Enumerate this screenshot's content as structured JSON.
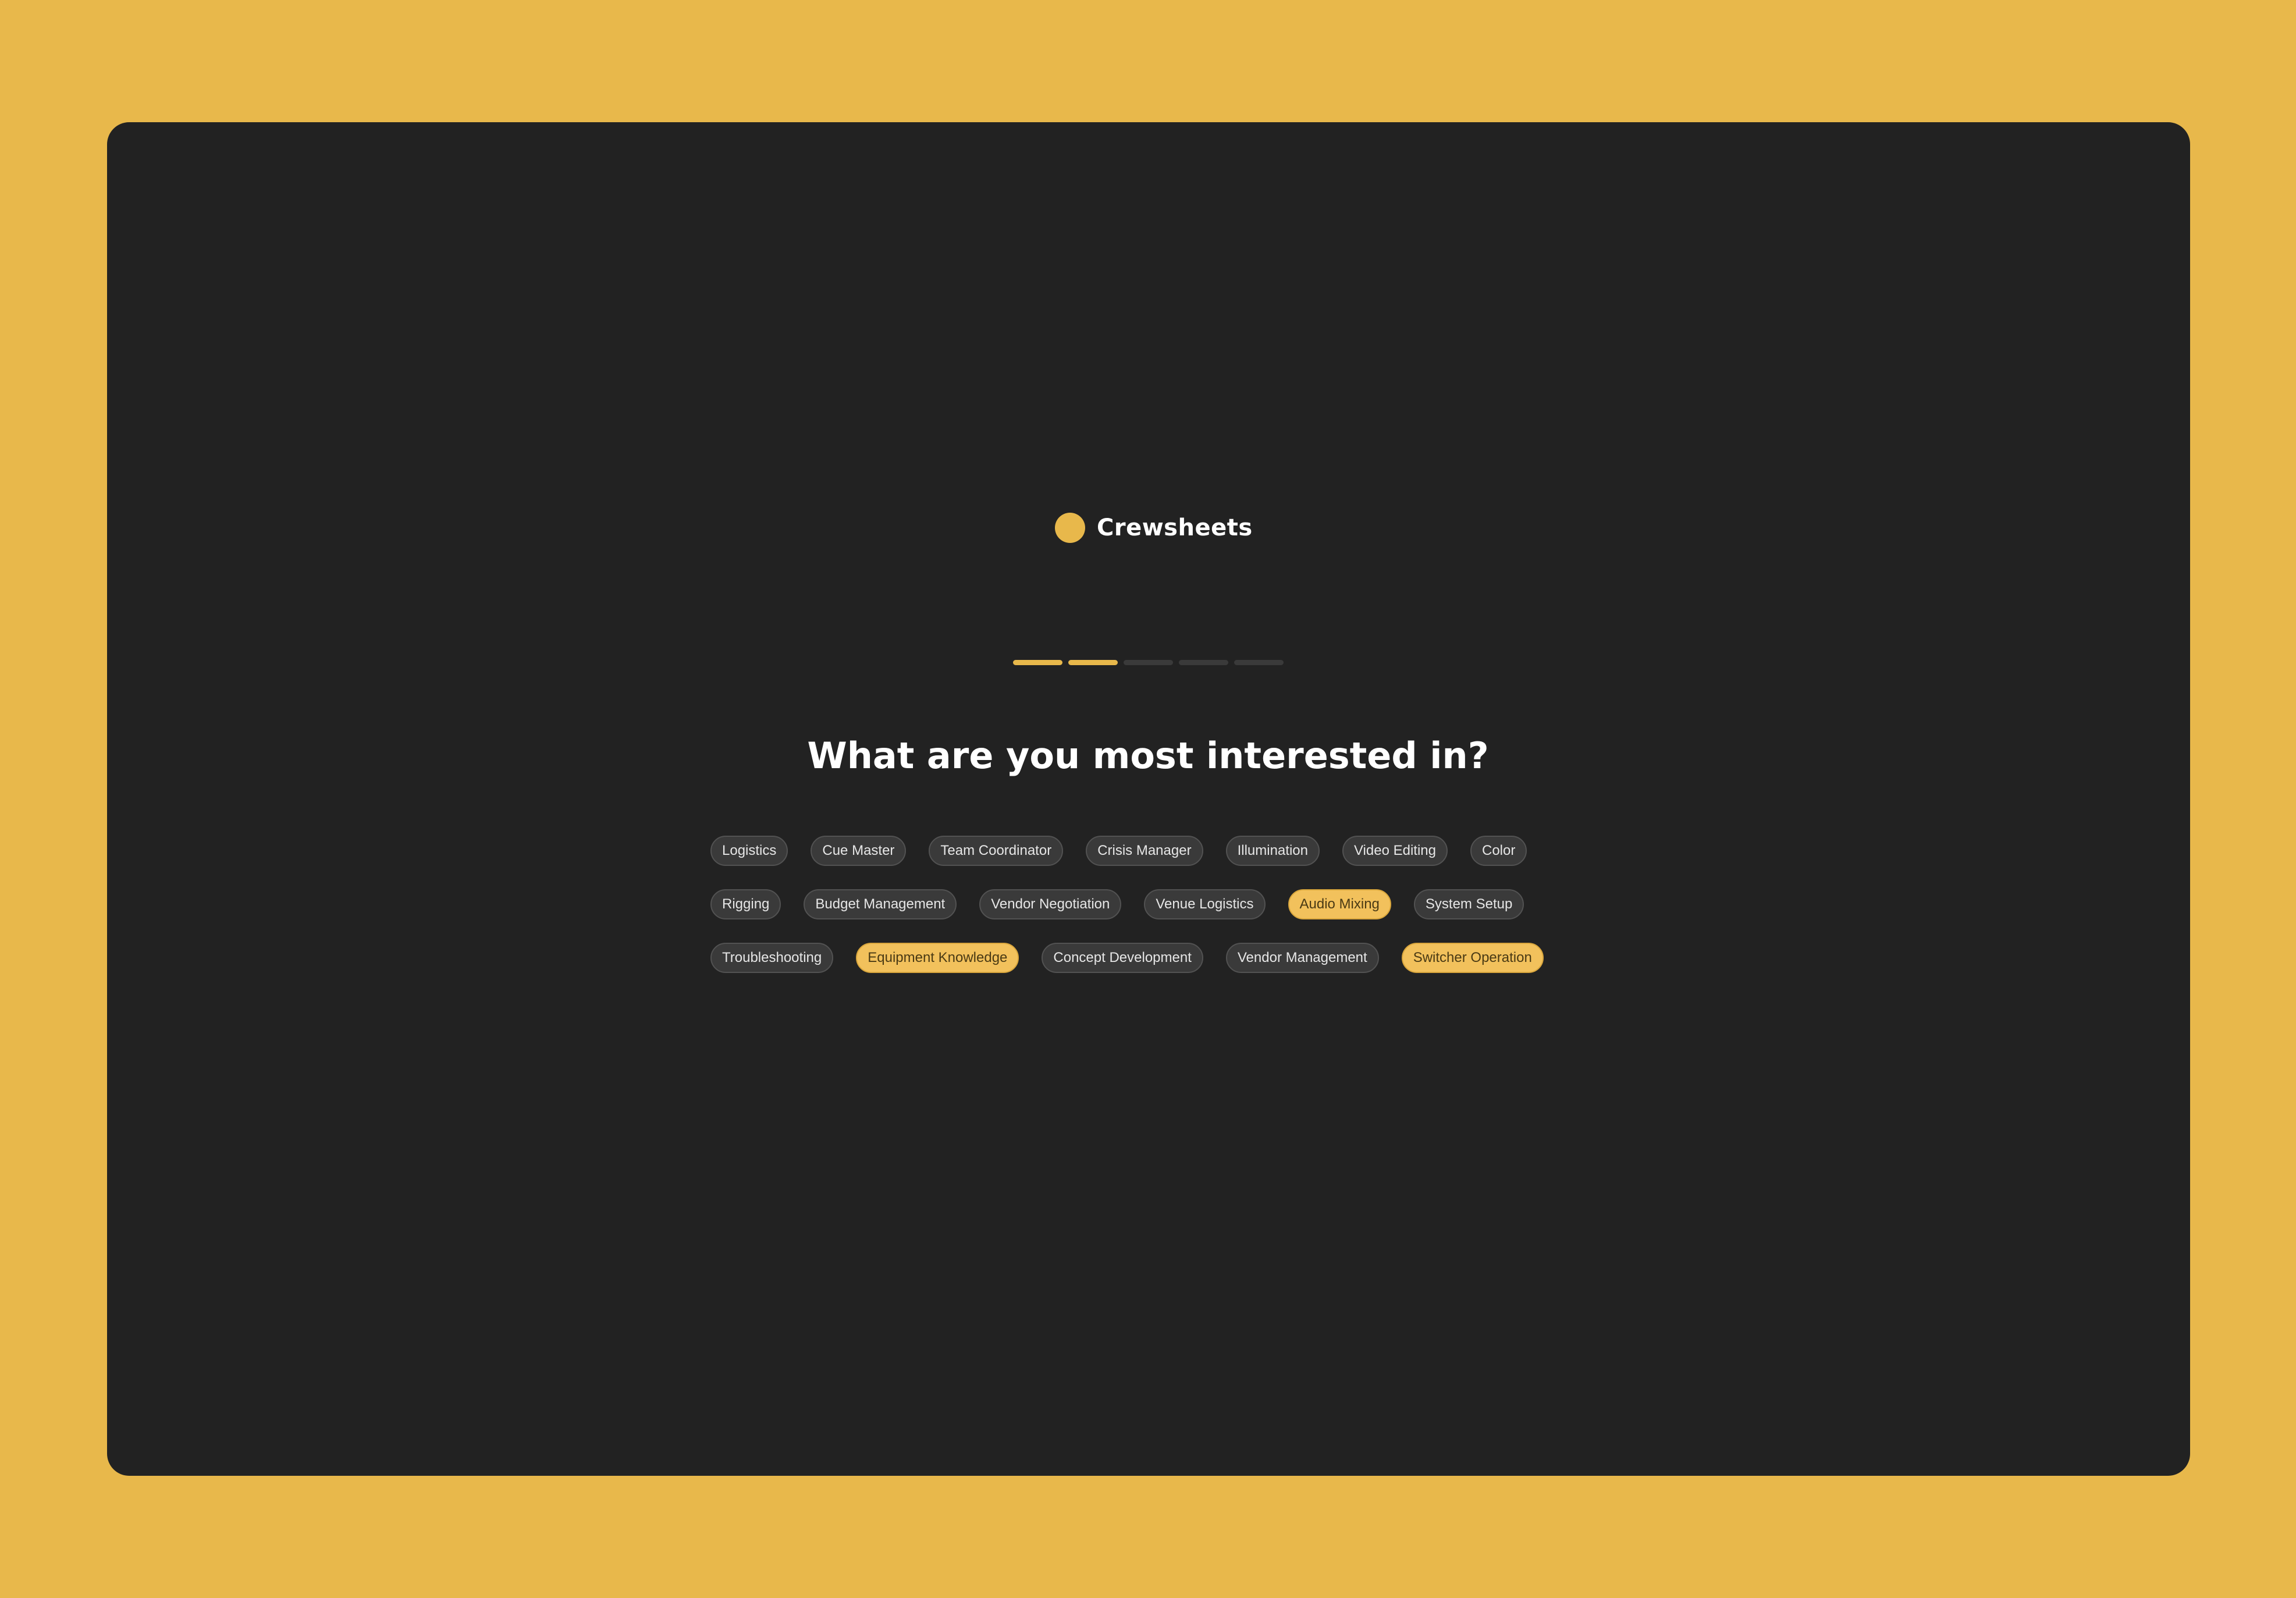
{
  "brand": {
    "name": "Crewsheets",
    "accent_color": "#E8B84B"
  },
  "progress": {
    "total_steps": 5,
    "completed_steps": 2
  },
  "question": "What are you most interested in?",
  "chip_rows": [
    [
      {
        "label": "Logistics",
        "selected": false
      },
      {
        "label": "Cue Master",
        "selected": false
      },
      {
        "label": "Team Coordinator",
        "selected": false
      },
      {
        "label": "Crisis Manager",
        "selected": false
      },
      {
        "label": "Illumination",
        "selected": false
      },
      {
        "label": "Video Editing",
        "selected": false
      },
      {
        "label": "Color",
        "selected": false
      }
    ],
    [
      {
        "label": "Rigging",
        "selected": false
      },
      {
        "label": "Budget Management",
        "selected": false
      },
      {
        "label": "Vendor Negotiation",
        "selected": false
      },
      {
        "label": "Venue Logistics",
        "selected": false
      },
      {
        "label": "Audio Mixing",
        "selected": true
      },
      {
        "label": "System Setup",
        "selected": false
      }
    ],
    [
      {
        "label": "Troubleshooting",
        "selected": false
      },
      {
        "label": "Equipment Knowledge",
        "selected": true
      },
      {
        "label": "Concept Development",
        "selected": false
      },
      {
        "label": "Vendor Management",
        "selected": false
      },
      {
        "label": "Switcher Operation",
        "selected": true
      }
    ]
  ]
}
